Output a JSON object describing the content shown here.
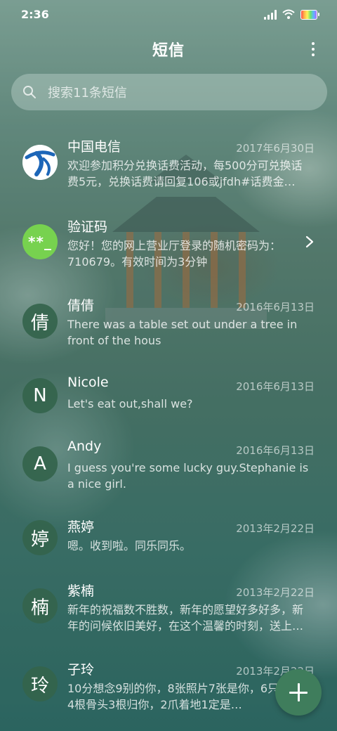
{
  "status_bar": {
    "time": "2:36"
  },
  "header": {
    "title": "短信",
    "more_icon": "more-vertical-icon"
  },
  "search": {
    "placeholder": "搜索11条短信",
    "icon": "search-icon"
  },
  "conversations": [
    {
      "name": "中国电信",
      "date": "2017年6月30日",
      "preview": "欢迎参加积分兑换话费活动，每500分可兑换话费5元，兑换话费请回复106或jfdh#话费金…",
      "avatar_type": "china-telecom-logo"
    },
    {
      "name": "验证码",
      "date": "",
      "preview": "您好！您的网上营业厅登录的随机密码为：710679。有效时间为3分钟",
      "avatar_text": "**_",
      "avatar_color": "#77d24f"
    },
    {
      "name": "倩倩",
      "date": "2016年6月13日",
      "preview": "There was a table set out under a tree in front of the hous",
      "avatar_text": "倩"
    },
    {
      "name": "Nicole",
      "date": "2016年6月13日",
      "preview": "Let's eat out,shall we?",
      "avatar_text": "N"
    },
    {
      "name": "Andy",
      "date": "2016年6月13日",
      "preview": "I guess you're some lucky guy.Stephanie is a nice girl.",
      "avatar_text": "A"
    },
    {
      "name": "燕婷",
      "date": "2013年2月22日",
      "preview": "嗯。收到啦。同乐同乐。",
      "avatar_text": "婷"
    },
    {
      "name": "紫楠",
      "date": "2013年2月22日",
      "preview": "新年的祝福数不胜数，新年的愿望好多好多，新年的问候依旧美好，在这个温馨的时刻，送上…",
      "avatar_text": "楠"
    },
    {
      "name": "子玲",
      "date": "2013年2月22日",
      "preview": "10分想念9别的你，8张照片7张是你，6只像你，4根骨头3根归你，2爪着地1定是…",
      "avatar_text": "玲"
    }
  ],
  "fab": {
    "icon": "plus-icon"
  },
  "colors": {
    "avatar_green": "#34644c",
    "fab_green": "#3f7d5c",
    "code_green": "#77d24f"
  }
}
